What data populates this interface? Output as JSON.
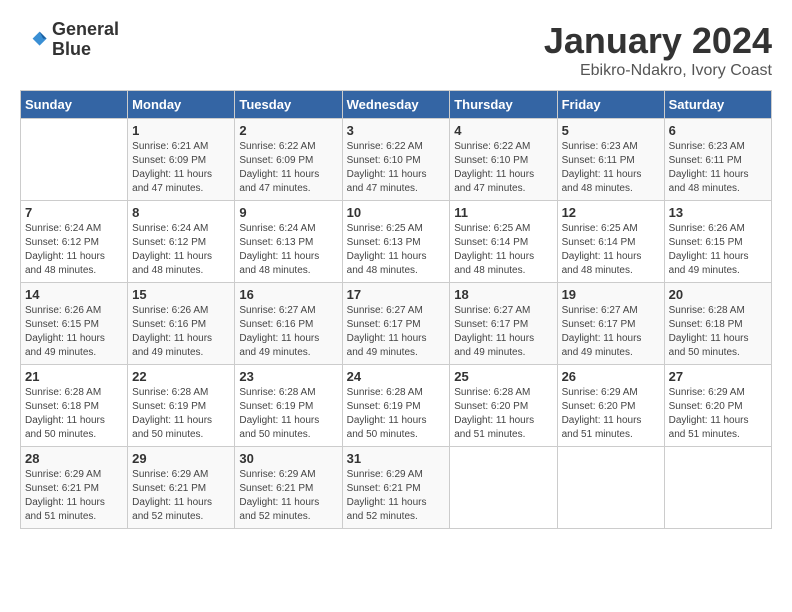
{
  "logo": {
    "line1": "General",
    "line2": "Blue"
  },
  "title": "January 2024",
  "subtitle": "Ebikro-Ndakro, Ivory Coast",
  "days_of_week": [
    "Sunday",
    "Monday",
    "Tuesday",
    "Wednesday",
    "Thursday",
    "Friday",
    "Saturday"
  ],
  "weeks": [
    [
      {
        "day": "",
        "info": ""
      },
      {
        "day": "1",
        "info": "Sunrise: 6:21 AM\nSunset: 6:09 PM\nDaylight: 11 hours and 47 minutes."
      },
      {
        "day": "2",
        "info": "Sunrise: 6:22 AM\nSunset: 6:09 PM\nDaylight: 11 hours and 47 minutes."
      },
      {
        "day": "3",
        "info": "Sunrise: 6:22 AM\nSunset: 6:10 PM\nDaylight: 11 hours and 47 minutes."
      },
      {
        "day": "4",
        "info": "Sunrise: 6:22 AM\nSunset: 6:10 PM\nDaylight: 11 hours and 47 minutes."
      },
      {
        "day": "5",
        "info": "Sunrise: 6:23 AM\nSunset: 6:11 PM\nDaylight: 11 hours and 48 minutes."
      },
      {
        "day": "6",
        "info": "Sunrise: 6:23 AM\nSunset: 6:11 PM\nDaylight: 11 hours and 48 minutes."
      }
    ],
    [
      {
        "day": "7",
        "info": "Sunrise: 6:24 AM\nSunset: 6:12 PM\nDaylight: 11 hours and 48 minutes."
      },
      {
        "day": "8",
        "info": "Sunrise: 6:24 AM\nSunset: 6:12 PM\nDaylight: 11 hours and 48 minutes."
      },
      {
        "day": "9",
        "info": "Sunrise: 6:24 AM\nSunset: 6:13 PM\nDaylight: 11 hours and 48 minutes."
      },
      {
        "day": "10",
        "info": "Sunrise: 6:25 AM\nSunset: 6:13 PM\nDaylight: 11 hours and 48 minutes."
      },
      {
        "day": "11",
        "info": "Sunrise: 6:25 AM\nSunset: 6:14 PM\nDaylight: 11 hours and 48 minutes."
      },
      {
        "day": "12",
        "info": "Sunrise: 6:25 AM\nSunset: 6:14 PM\nDaylight: 11 hours and 48 minutes."
      },
      {
        "day": "13",
        "info": "Sunrise: 6:26 AM\nSunset: 6:15 PM\nDaylight: 11 hours and 49 minutes."
      }
    ],
    [
      {
        "day": "14",
        "info": "Sunrise: 6:26 AM\nSunset: 6:15 PM\nDaylight: 11 hours and 49 minutes."
      },
      {
        "day": "15",
        "info": "Sunrise: 6:26 AM\nSunset: 6:16 PM\nDaylight: 11 hours and 49 minutes."
      },
      {
        "day": "16",
        "info": "Sunrise: 6:27 AM\nSunset: 6:16 PM\nDaylight: 11 hours and 49 minutes."
      },
      {
        "day": "17",
        "info": "Sunrise: 6:27 AM\nSunset: 6:17 PM\nDaylight: 11 hours and 49 minutes."
      },
      {
        "day": "18",
        "info": "Sunrise: 6:27 AM\nSunset: 6:17 PM\nDaylight: 11 hours and 49 minutes."
      },
      {
        "day": "19",
        "info": "Sunrise: 6:27 AM\nSunset: 6:17 PM\nDaylight: 11 hours and 49 minutes."
      },
      {
        "day": "20",
        "info": "Sunrise: 6:28 AM\nSunset: 6:18 PM\nDaylight: 11 hours and 50 minutes."
      }
    ],
    [
      {
        "day": "21",
        "info": "Sunrise: 6:28 AM\nSunset: 6:18 PM\nDaylight: 11 hours and 50 minutes."
      },
      {
        "day": "22",
        "info": "Sunrise: 6:28 AM\nSunset: 6:19 PM\nDaylight: 11 hours and 50 minutes."
      },
      {
        "day": "23",
        "info": "Sunrise: 6:28 AM\nSunset: 6:19 PM\nDaylight: 11 hours and 50 minutes."
      },
      {
        "day": "24",
        "info": "Sunrise: 6:28 AM\nSunset: 6:19 PM\nDaylight: 11 hours and 50 minutes."
      },
      {
        "day": "25",
        "info": "Sunrise: 6:28 AM\nSunset: 6:20 PM\nDaylight: 11 hours and 51 minutes."
      },
      {
        "day": "26",
        "info": "Sunrise: 6:29 AM\nSunset: 6:20 PM\nDaylight: 11 hours and 51 minutes."
      },
      {
        "day": "27",
        "info": "Sunrise: 6:29 AM\nSunset: 6:20 PM\nDaylight: 11 hours and 51 minutes."
      }
    ],
    [
      {
        "day": "28",
        "info": "Sunrise: 6:29 AM\nSunset: 6:21 PM\nDaylight: 11 hours and 51 minutes."
      },
      {
        "day": "29",
        "info": "Sunrise: 6:29 AM\nSunset: 6:21 PM\nDaylight: 11 hours and 52 minutes."
      },
      {
        "day": "30",
        "info": "Sunrise: 6:29 AM\nSunset: 6:21 PM\nDaylight: 11 hours and 52 minutes."
      },
      {
        "day": "31",
        "info": "Sunrise: 6:29 AM\nSunset: 6:21 PM\nDaylight: 11 hours and 52 minutes."
      },
      {
        "day": "",
        "info": ""
      },
      {
        "day": "",
        "info": ""
      },
      {
        "day": "",
        "info": ""
      }
    ]
  ]
}
